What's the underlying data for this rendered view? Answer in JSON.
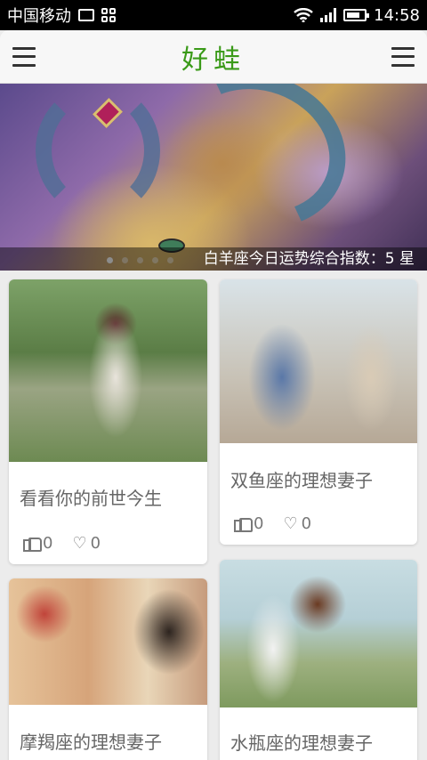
{
  "status_bar": {
    "carrier": "中国移动",
    "time": "14:58"
  },
  "header": {
    "title": "好蛙"
  },
  "banner": {
    "caption": "白羊座今日运势综合指数：5 星",
    "slide_count": 5,
    "active_slide": 1
  },
  "cards": [
    {
      "title": "看看你的前世今生",
      "likes": "0",
      "favorites": "0"
    },
    {
      "title": "双鱼座的理想妻子",
      "likes": "0",
      "favorites": "0"
    },
    {
      "title": "摩羯座的理想妻子"
    },
    {
      "title": "水瓶座的理想妻子"
    }
  ],
  "icons": {
    "menu_left": "menu-icon",
    "menu_right": "menu-icon",
    "like": "thumbs-up-icon",
    "favorite": "heart-icon"
  },
  "colors": {
    "title_green": "#3a9a18",
    "background": "#ececec"
  }
}
